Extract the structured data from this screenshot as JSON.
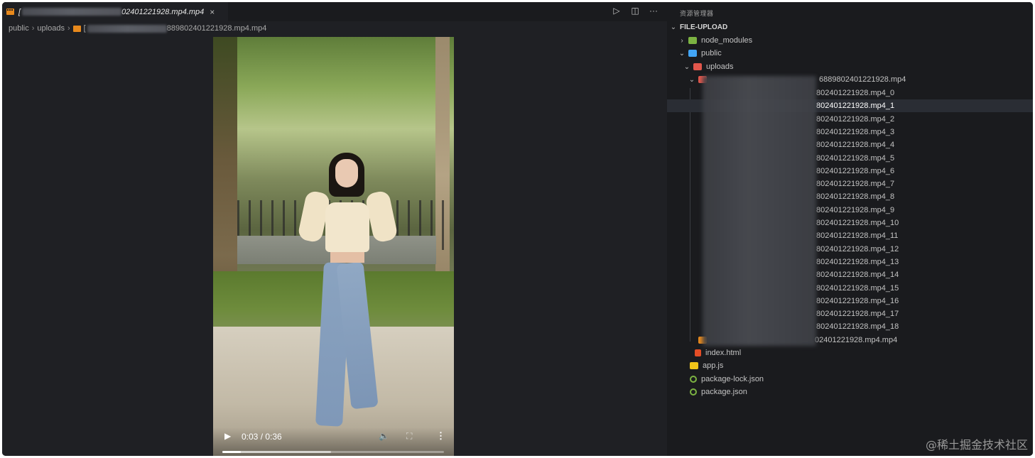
{
  "tab": {
    "label_suffix": "02401221928.mp4.mp4",
    "close": "×"
  },
  "editor_actions": {
    "run": "▷",
    "split": "◫",
    "more": "···"
  },
  "breadcrumb": {
    "items": [
      "public",
      "uploads"
    ],
    "file_suffix": "889802401221928.mp4.mp4",
    "sep": "›"
  },
  "video": {
    "time": "0:03 / 0:36",
    "progress": 0.083,
    "buffered": 0.49,
    "play_icon": "▶",
    "volume_icon": "🔈",
    "fullscreen_icon": "⛶",
    "menu_icon": "⋮"
  },
  "explorer": {
    "title": "资源管理器",
    "root": "FILE-UPLOAD",
    "node_modules": "node_modules",
    "public": "public",
    "uploads": "uploads",
    "upload_dir": "6889802401221928.mp4",
    "chunks": [
      "802401221928.mp4_0",
      "802401221928.mp4_1",
      "802401221928.mp4_2",
      "802401221928.mp4_3",
      "802401221928.mp4_4",
      "802401221928.mp4_5",
      "802401221928.mp4_6",
      "802401221928.mp4_7",
      "802401221928.mp4_8",
      "802401221928.mp4_9",
      "802401221928.mp4_10",
      "802401221928.mp4_11",
      "802401221928.mp4_12",
      "802401221928.mp4_13",
      "802401221928.mp4_14",
      "802401221928.mp4_15",
      "802401221928.mp4_16",
      "802401221928.mp4_17",
      "802401221928.mp4_18"
    ],
    "merged_file": "02401221928.mp4.mp4",
    "index_html": "index.html",
    "app_js": "app.js",
    "package_lock": "package-lock.json",
    "package_json": "package.json",
    "selected_index": 1
  },
  "watermark": "@稀土掘金技术社区"
}
